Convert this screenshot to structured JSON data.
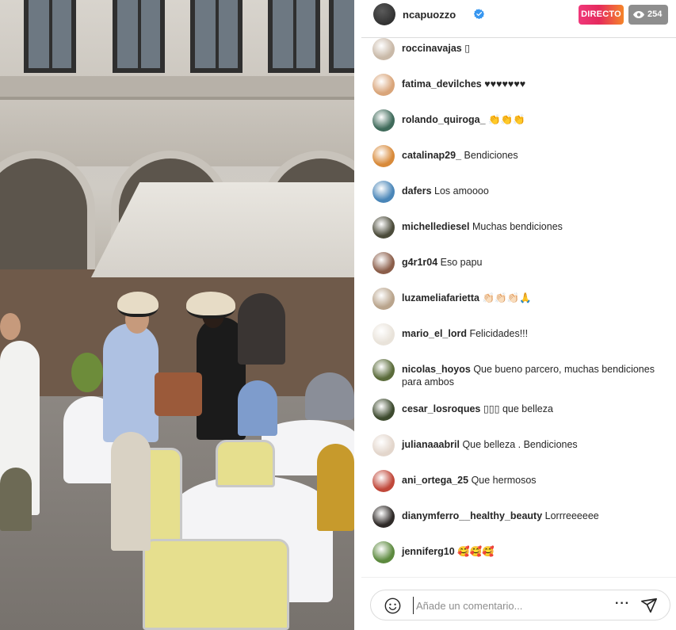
{
  "stream": {
    "username": "ncapuozzo",
    "verified": true,
    "live_label": "DIRECTO",
    "viewer_count": "254",
    "colors": {
      "live_start": "#e52a5d",
      "live_end": "#f58529",
      "viewers_bg": "#8e8e8e",
      "verified": "#3897f0"
    }
  },
  "comments": [
    {
      "user": "roccinavajas",
      "text": "▯",
      "avatar_color": "#c9b9a8"
    },
    {
      "user": "fatima_devilches",
      "text": "♥♥♥♥♥♥♥",
      "avatar_color": "#d9a57a"
    },
    {
      "user": "rolando_quiroga_",
      "text": "👏👏👏",
      "avatar_color": "#3f6a5a"
    },
    {
      "user": "catalinap29_",
      "text": "Bendiciones",
      "avatar_color": "#d88a3a"
    },
    {
      "user": "dafers",
      "text": "Los amoooo",
      "avatar_color": "#4a86b8"
    },
    {
      "user": "michellediesel",
      "text": "Muchas bendiciones",
      "avatar_color": "#4b4b3a"
    },
    {
      "user": "g4r1r04",
      "text": "Eso papu",
      "avatar_color": "#8b5e4a"
    },
    {
      "user": "luzameliafarietta",
      "text": "👏🏻👏🏻👏🏻🙏",
      "avatar_color": "#b9a48c"
    },
    {
      "user": "mario_el_lord",
      "text": "Felicidades!!!",
      "avatar_color": "#e9e3da"
    },
    {
      "user": "nicolas_hoyos",
      "text": "Que bueno parcero, muchas bendiciones para ambos",
      "avatar_color": "#5a6b3a"
    },
    {
      "user": "cesar_losroques",
      "text": "▯▯▯ que belleza",
      "avatar_color": "#3d4a2e"
    },
    {
      "user": "julianaaabril",
      "text": "Que belleza . Bendiciones",
      "avatar_color": "#e3d6cc"
    },
    {
      "user": "ani_ortega_25",
      "text": "Que hermosos",
      "avatar_color": "#c0483a"
    },
    {
      "user": "dianymferro__healthy_beauty",
      "text": "Lorrreeeeee",
      "avatar_color": "#2f2a28"
    },
    {
      "user": "jenniferg10",
      "text": "🥰🥰🥰",
      "avatar_color": "#5d8a3f"
    }
  ],
  "composer": {
    "placeholder": "Añade un comentario...",
    "emoji_icon": "smiley-icon",
    "more_icon": "ellipsis-icon",
    "send_icon": "paper-plane-icon"
  }
}
